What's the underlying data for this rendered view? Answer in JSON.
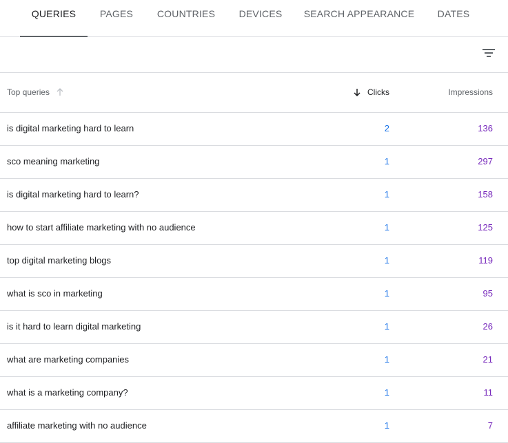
{
  "tabs": [
    {
      "label": "QUERIES",
      "active": true
    },
    {
      "label": "PAGES",
      "active": false
    },
    {
      "label": "COUNTRIES",
      "active": false
    },
    {
      "label": "DEVICES",
      "active": false
    },
    {
      "label": "SEARCH APPEARANCE",
      "active": false
    },
    {
      "label": "DATES",
      "active": false
    }
  ],
  "toolbar": {
    "filter_icon": "filter-icon"
  },
  "table": {
    "headers": {
      "query": "Top queries",
      "clicks": "Clicks",
      "impressions": "Impressions"
    },
    "sort": {
      "column": "clicks",
      "direction": "descending"
    },
    "rows": [
      {
        "query": "is digital marketing hard to learn",
        "clicks": "2",
        "impressions": "136"
      },
      {
        "query": "sco meaning marketing",
        "clicks": "1",
        "impressions": "297"
      },
      {
        "query": "is digital marketing hard to learn?",
        "clicks": "1",
        "impressions": "158"
      },
      {
        "query": "how to start affiliate marketing with no audience",
        "clicks": "1",
        "impressions": "125"
      },
      {
        "query": "top digital marketing blogs",
        "clicks": "1",
        "impressions": "119"
      },
      {
        "query": "what is sco in marketing",
        "clicks": "1",
        "impressions": "95"
      },
      {
        "query": "is it hard to learn digital marketing",
        "clicks": "1",
        "impressions": "26"
      },
      {
        "query": "what are marketing companies",
        "clicks": "1",
        "impressions": "21"
      },
      {
        "query": "what is a marketing company?",
        "clicks": "1",
        "impressions": "11"
      },
      {
        "query": "affiliate marketing with no audience",
        "clicks": "1",
        "impressions": "7"
      }
    ]
  },
  "colors": {
    "clicks": "#1a73e8",
    "impressions": "#7627bb",
    "divider": "#dadce0",
    "tab_inactive": "#5f6368",
    "tab_active": "#202124"
  }
}
